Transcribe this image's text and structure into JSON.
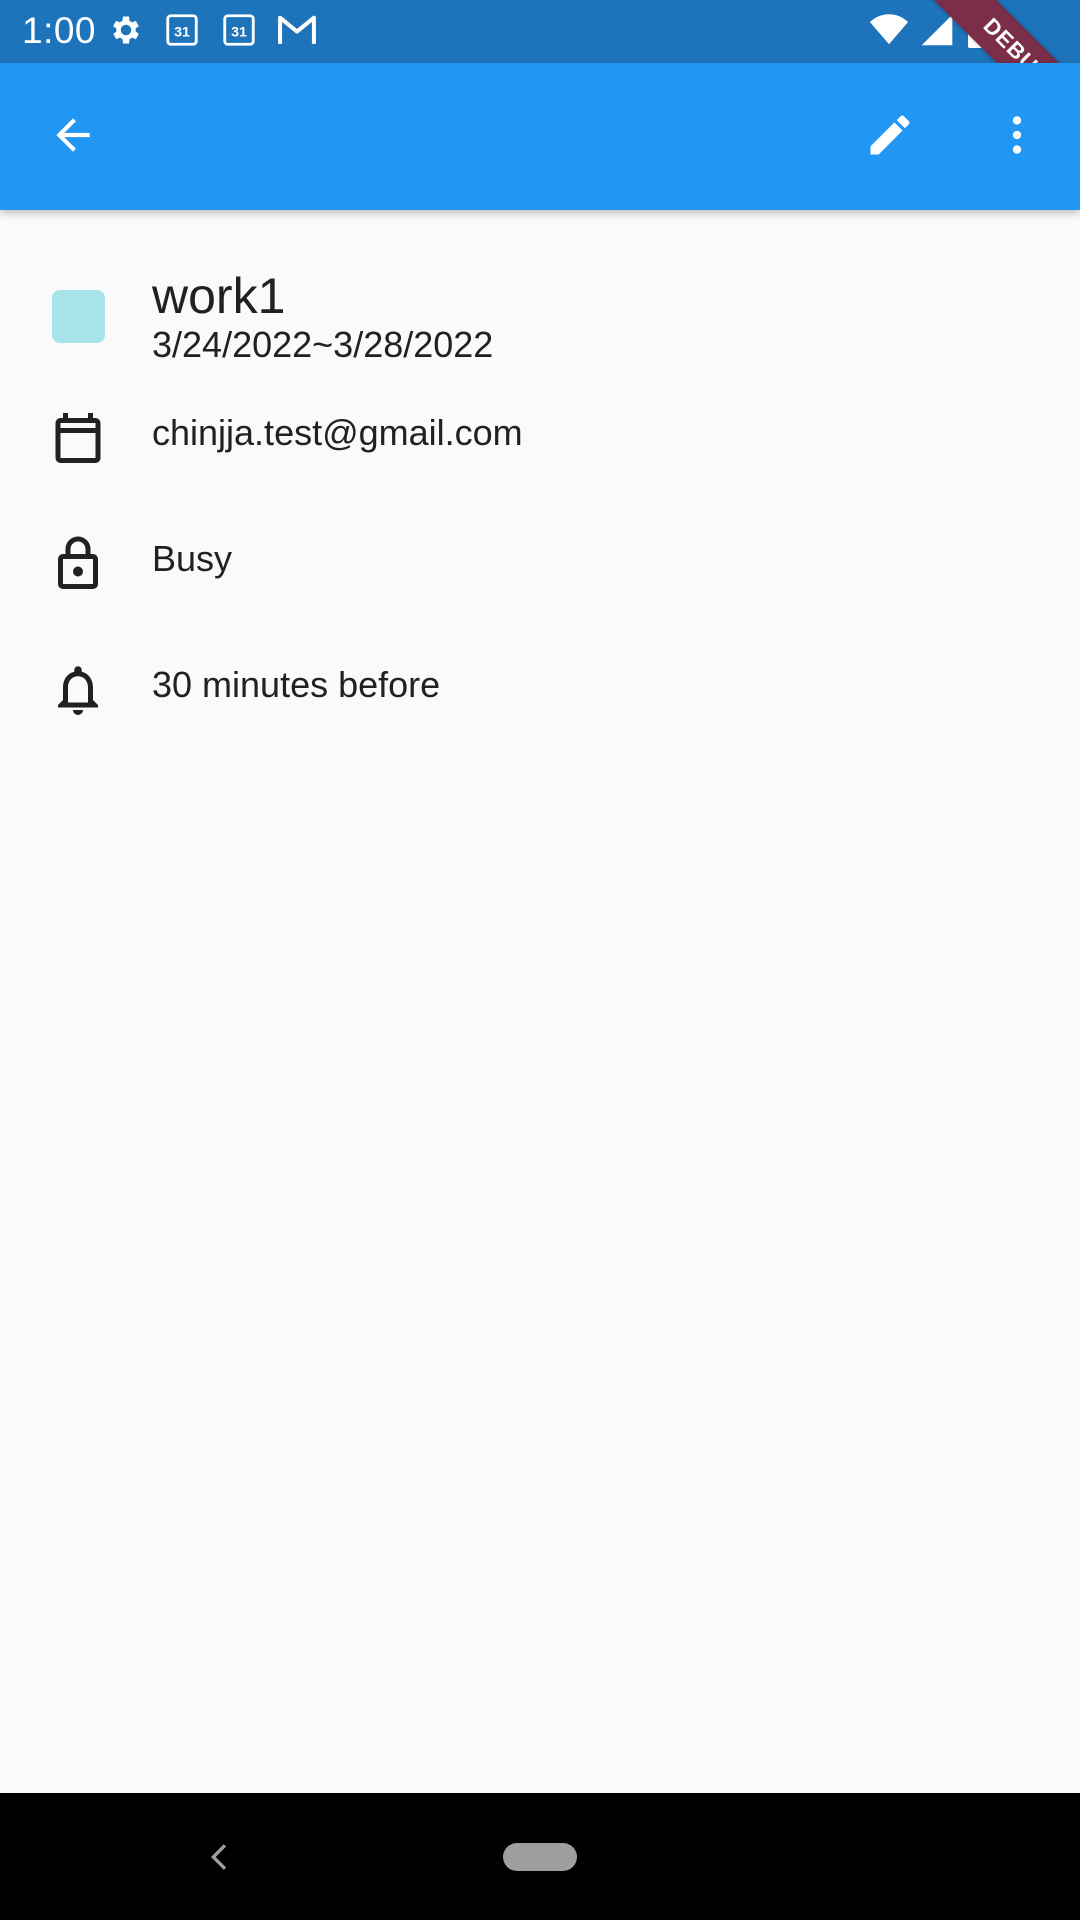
{
  "status_bar": {
    "time": "1:00",
    "left_icons": [
      "settings-icon",
      "calendar-31-icon",
      "calendar-31-icon",
      "gmail-icon"
    ],
    "right_icons": [
      "wifi-icon",
      "signal-icon",
      "battery-icon"
    ],
    "background": "#1d74bb"
  },
  "debug_banner": {
    "label": "DEBUG",
    "color": "#7a2e49"
  },
  "app_bar": {
    "background": "#2196f3",
    "back_icon": "arrow-back-icon",
    "actions": [
      "edit-icon",
      "more-vert-icon"
    ]
  },
  "event": {
    "title": "work1",
    "dates": "3/24/2022~3/28/2022",
    "color": "#a7e4ea"
  },
  "details": [
    {
      "icon": "calendar-icon",
      "label": "chinjja.test@gmail.com"
    },
    {
      "icon": "lock-icon",
      "label": "Busy"
    },
    {
      "icon": "bell-icon",
      "label": "30 minutes before"
    }
  ],
  "nav_bar": {
    "back_icon": "nav-back-icon",
    "home_icon": "nav-home-pill"
  }
}
